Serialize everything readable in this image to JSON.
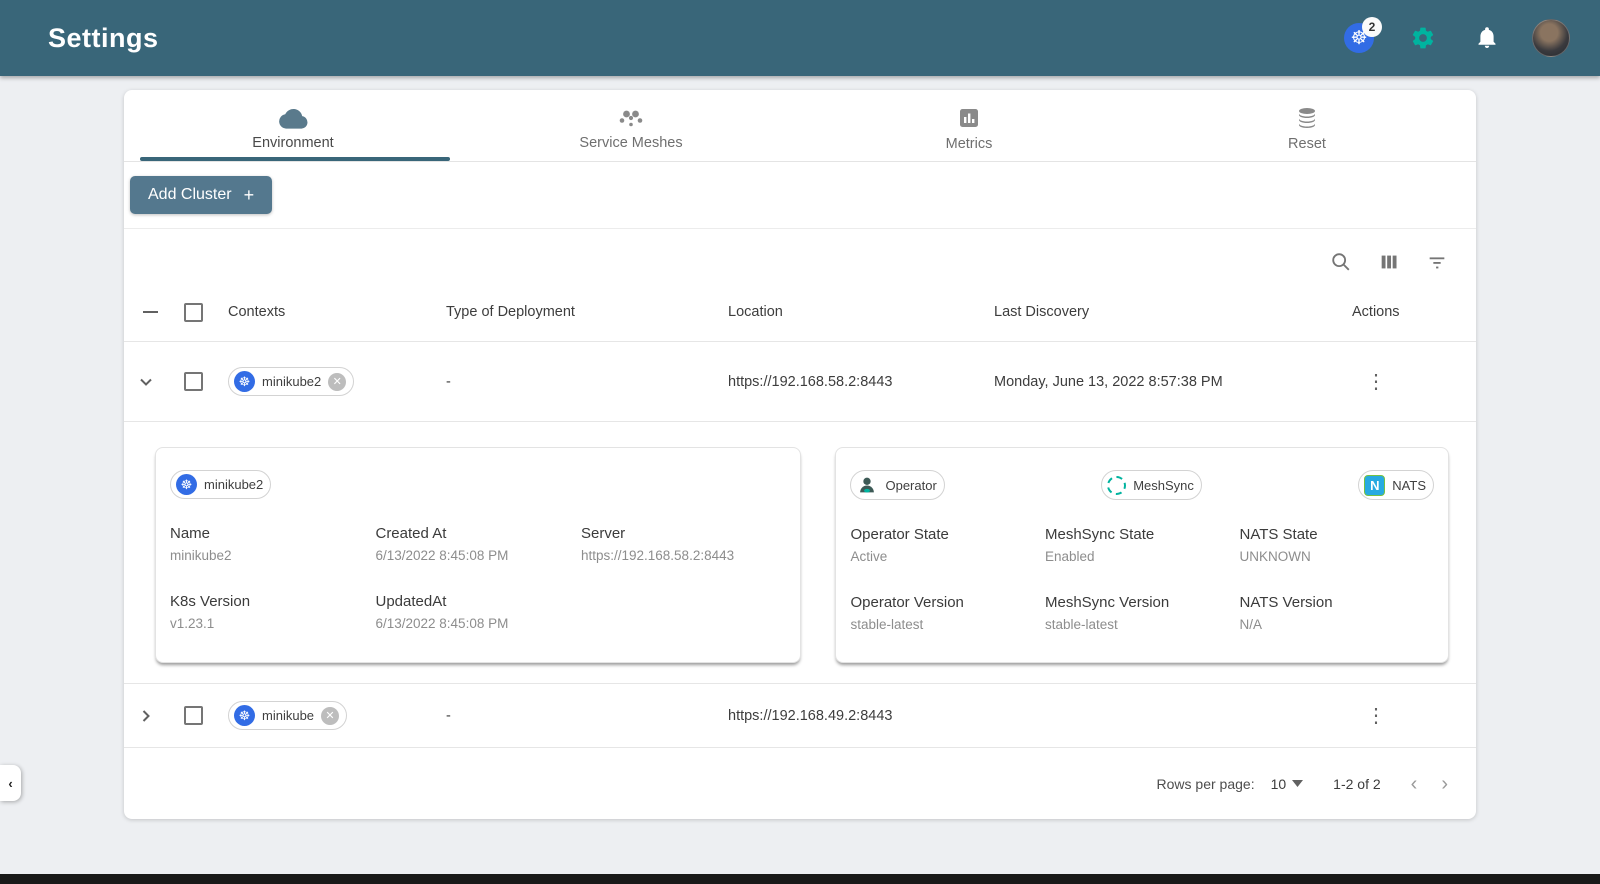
{
  "colors": {
    "header_bg": "#396679",
    "accent_green": "#00B39F",
    "k8s_blue": "#326CE5",
    "button_bg": "#54788e",
    "nats_blue": "#27AAE1"
  },
  "header": {
    "title": "Settings",
    "k8s_badge_count": "2"
  },
  "tabs": [
    {
      "label": "Environment",
      "active": true
    },
    {
      "label": "Service Meshes",
      "active": false
    },
    {
      "label": "Metrics",
      "active": false
    },
    {
      "label": "Reset",
      "active": false
    }
  ],
  "toolbar": {
    "add_cluster_label": "Add Cluster",
    "plus": "+"
  },
  "table": {
    "columns": [
      "Contexts",
      "Type of Deployment",
      "Location",
      "Last Discovery",
      "Actions"
    ],
    "rows": [
      {
        "context": "minikube2",
        "deployment_type": "-",
        "location": "https://192.168.58.2:8443",
        "last_discovery": "Monday, June 13, 2022 8:57:38 PM",
        "expanded": true
      },
      {
        "context": "minikube",
        "deployment_type": "-",
        "location": "https://192.168.49.2:8443",
        "last_discovery": "",
        "expanded": false
      }
    ]
  },
  "detail": {
    "cluster_chip": "minikube2",
    "left_fields": [
      {
        "label": "Name",
        "value": "minikube2"
      },
      {
        "label": "Created At",
        "value": "6/13/2022 8:45:08 PM"
      },
      {
        "label": "Server",
        "value": "https://192.168.58.2:8443"
      },
      {
        "label": "K8s Version",
        "value": "v1.23.1"
      },
      {
        "label": "UpdatedAt",
        "value": "6/13/2022 8:45:08 PM"
      }
    ],
    "chips": [
      {
        "label": "Operator"
      },
      {
        "label": "MeshSync"
      },
      {
        "label": "NATS"
      }
    ],
    "nats_letter": "N",
    "right_fields": [
      {
        "label": "Operator State",
        "value": "Active"
      },
      {
        "label": "MeshSync State",
        "value": "Enabled"
      },
      {
        "label": "NATS State",
        "value": "UNKNOWN"
      },
      {
        "label": "Operator Version",
        "value": "stable-latest"
      },
      {
        "label": "MeshSync Version",
        "value": "stable-latest"
      },
      {
        "label": "NATS Version",
        "value": "N/A"
      }
    ]
  },
  "pagination": {
    "rows_per_page_label": "Rows per page:",
    "rows_per_page_value": "10",
    "range": "1-2 of 2",
    "prev": "‹",
    "next": "›"
  },
  "misc": {
    "collapse_handle": "‹",
    "k8s_glyph": "☸",
    "x_glyph": "✕",
    "dots_glyph": "⋮"
  }
}
